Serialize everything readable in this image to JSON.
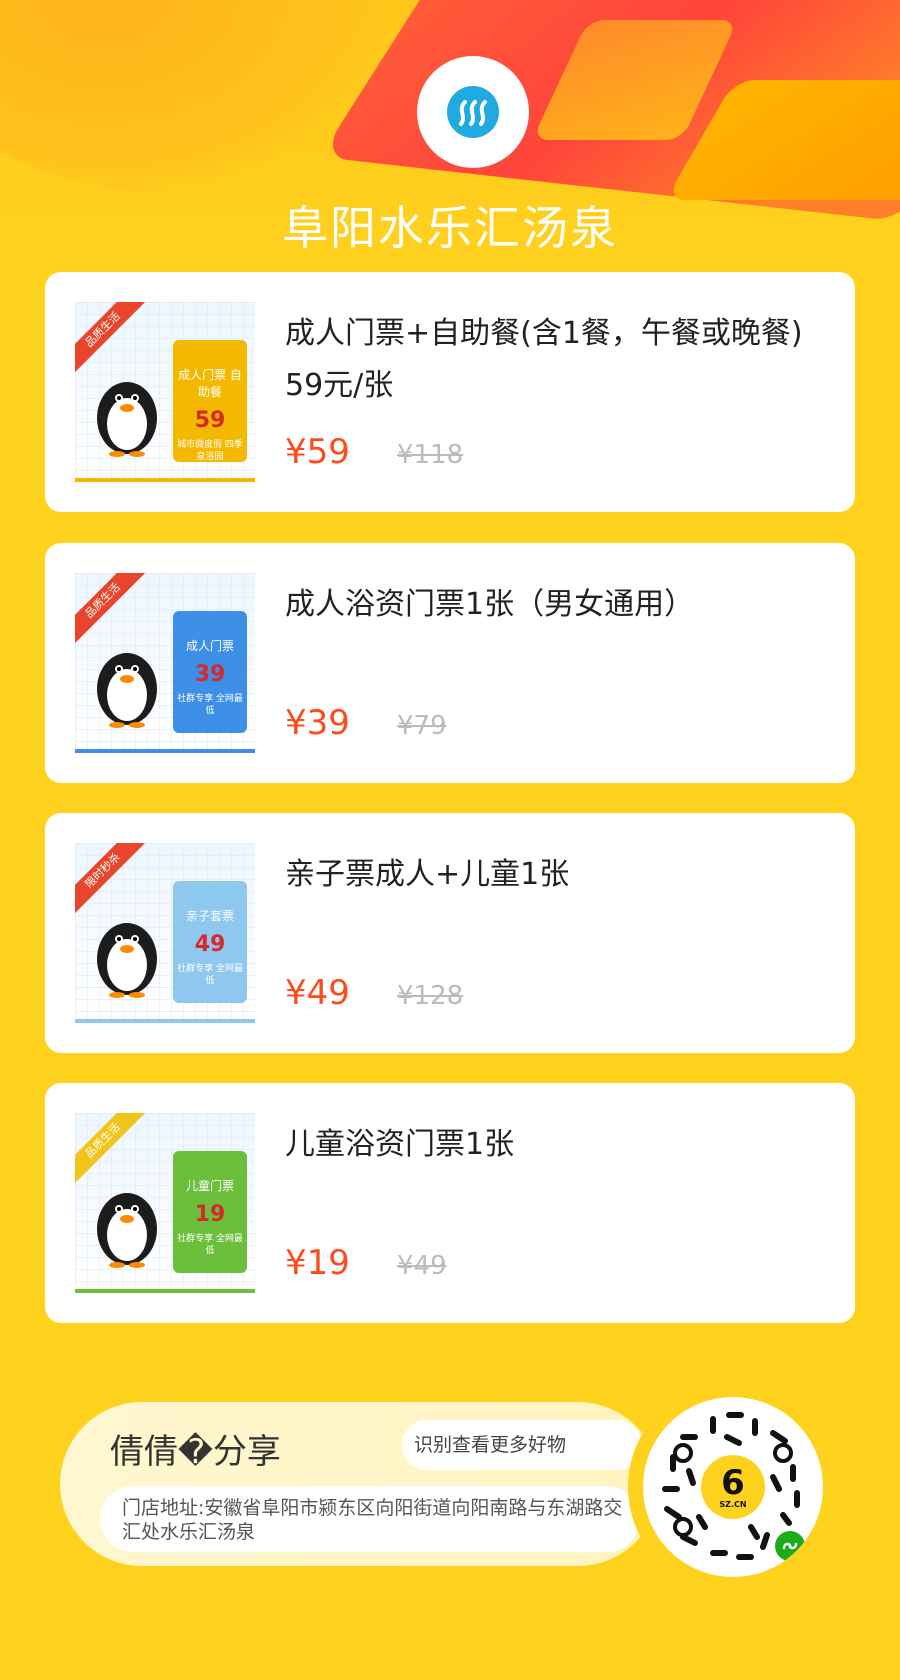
{
  "store": {
    "name": "阜阳水乐汇汤泉",
    "logo_icon": "waves-logo-icon"
  },
  "products": [
    {
      "title": "成人门票+自助餐(含1餐，午餐或晚餐)　 59元/张",
      "price": "¥59",
      "original_price": "¥118",
      "thumb": {
        "ribbon": "品质生活",
        "ribbon_color": "#e8452c",
        "ticket_color": "#f5b800",
        "ticket_name": "成人门票 自助餐",
        "ticket_price": "59",
        "ticket_note": "城市微度假 四季泉浴园"
      }
    },
    {
      "title": "成人浴资门票1张（男女通用）",
      "price": "¥39",
      "original_price": "¥79",
      "thumb": {
        "ribbon": "品质生活",
        "ribbon_color": "#e8452c",
        "ticket_color": "#3d8fe8",
        "ticket_name": "成人门票",
        "ticket_price": "39",
        "ticket_note": "社群专享 全网最低"
      }
    },
    {
      "title": "亲子票成人+儿童1张",
      "price": "¥49",
      "original_price": "¥128",
      "thumb": {
        "ribbon": "限时秒杀",
        "ribbon_color": "#e8452c",
        "ticket_color": "#8ec8ef",
        "ticket_name": "亲子套票",
        "ticket_price": "49",
        "ticket_note": "社群专享 全网最低"
      }
    },
    {
      "title": "儿童浴资门票1张",
      "price": "¥19",
      "original_price": "¥49",
      "thumb": {
        "ribbon": "品质生活",
        "ribbon_color": "#f0c419",
        "ticket_color": "#6cbf3a",
        "ticket_name": "儿童门票",
        "ticket_price": "19",
        "ticket_note": "社群专享 全网最低"
      }
    }
  ],
  "footer": {
    "sharer": "倩倩�分享",
    "scan_hint": "识别查看更多好物",
    "address": "门店地址:安徽省阜阳市颍东区向阳街道向阳南路与东湖路交汇处水乐汇汤泉",
    "qr_center_mark": "6",
    "qr_center_text": "SZ.CN",
    "qr_badge_icon": "wechat-mini-program-icon"
  }
}
